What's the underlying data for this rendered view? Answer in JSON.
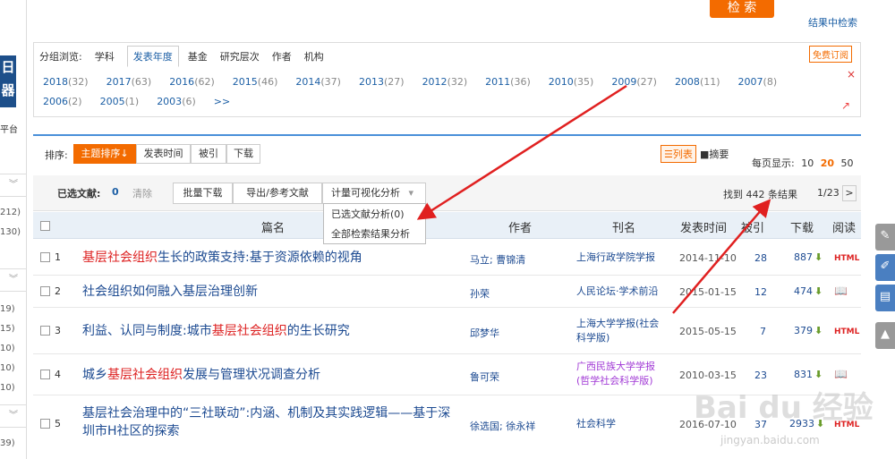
{
  "search": {
    "button_label": "检 索",
    "in_result": "结果中检索"
  },
  "leftbar": {
    "logo_text": "日\n器",
    "platform": "平台",
    "counts_a": [
      "212)",
      "130)"
    ],
    "counts_b": [
      "19)",
      "15)",
      "10)",
      "10)",
      "10)"
    ],
    "counts_c": [
      "39)"
    ]
  },
  "group": {
    "label": "分组浏览:",
    "tabs": [
      "学科",
      "发表年度",
      "基金",
      "研究层次",
      "作者",
      "机构"
    ],
    "active_tab": "发表年度",
    "subscribe": "免费订阅",
    "years_row1": [
      {
        "y": "2018",
        "c": "(32)"
      },
      {
        "y": "2017",
        "c": "(63)"
      },
      {
        "y": "2016",
        "c": "(62)"
      },
      {
        "y": "2015",
        "c": "(46)"
      },
      {
        "y": "2014",
        "c": "(37)"
      },
      {
        "y": "2013",
        "c": "(27)"
      },
      {
        "y": "2012",
        "c": "(32)"
      },
      {
        "y": "2011",
        "c": "(36)"
      },
      {
        "y": "2010",
        "c": "(35)"
      },
      {
        "y": "2009",
        "c": "(27)"
      },
      {
        "y": "2008",
        "c": "(11)"
      },
      {
        "y": "2007",
        "c": "(8)"
      }
    ],
    "years_row2": [
      {
        "y": "2006",
        "c": "(2)"
      },
      {
        "y": "2005",
        "c": "(1)"
      },
      {
        "y": "2003",
        "c": "(6)"
      }
    ],
    "more": ">>",
    "close": "×"
  },
  "sort": {
    "label": "排序:",
    "buttons": [
      "主题排序↓",
      "发表时间",
      "被引",
      "下载"
    ],
    "view_list": "☰列表",
    "view_abstract": "■摘要",
    "per_page_label": "每页显示:",
    "per_page": [
      "10",
      "20",
      "50"
    ],
    "per_page_active": "20"
  },
  "tools": {
    "selected_label": "已选文献:",
    "selected_count": "0",
    "clear": "清除",
    "batch_download": "批量下载",
    "export": "导出/参考文献",
    "visual": "计量可视化分析",
    "visual_arrow": "▾",
    "dropdown": [
      "已选文献分析(0)",
      "全部检索结果分析"
    ],
    "found": "找到 442 条结果",
    "pager": "1/23",
    "next": ">"
  },
  "table": {
    "headers": [
      "篇名",
      "作者",
      "刊名",
      "发表时间",
      "被引",
      "下载",
      "阅读"
    ],
    "rows": [
      {
        "num": "1",
        "pre": "",
        "hl": "基层社会组织",
        "post": "生长的政策支持:基于资源依赖的视角",
        "author": "马立; 曹锦清",
        "journal": "上海行政学院学报",
        "date": "2014-11-10",
        "cite": "28",
        "dl": "887",
        "read": "HTML"
      },
      {
        "num": "2",
        "pre": "社会组织如何融入基层治理创新",
        "hl": "",
        "post": "",
        "author": "孙荣",
        "journal": "人民论坛·学术前沿",
        "date": "2015-01-15",
        "cite": "12",
        "dl": "474",
        "read": "📖"
      },
      {
        "num": "3",
        "pre": "利益、认同与制度:城市",
        "hl": "基层社会组织",
        "post": "的生长研究",
        "author": "邱梦华",
        "journal": "上海大学学报(社会科学版)",
        "date": "2015-05-15",
        "cite": "7",
        "dl": "379",
        "read": "HTML"
      },
      {
        "num": "4",
        "pre": "城乡",
        "hl": "基层社会组织",
        "post": "发展与管理状况调查分析",
        "author": "鲁可荣",
        "journal": "广西民族大学学报(哲学社会科学版)",
        "date": "2010-03-15",
        "cite": "23",
        "dl": "831",
        "read": "📖"
      },
      {
        "num": "5",
        "pre": "基层社会治理中的“三社联动”:内涵、机制及其实践逻辑——基于深圳市H社区的探索",
        "hl": "",
        "post": "",
        "author": "徐选国; 徐永祥",
        "journal": "社会科学",
        "date": "2016-07-10",
        "cite": "37",
        "dl": "2933",
        "read": "HTML"
      }
    ]
  },
  "colors": {
    "accent": "#f36b00",
    "link": "#1c4a91",
    "highlight": "#d22222",
    "header_bg": "#e9f0f7",
    "arrow": "#e02020"
  },
  "watermark": {
    "main": "Bai du 经验",
    "sub": "jingyan.baidu.com"
  }
}
